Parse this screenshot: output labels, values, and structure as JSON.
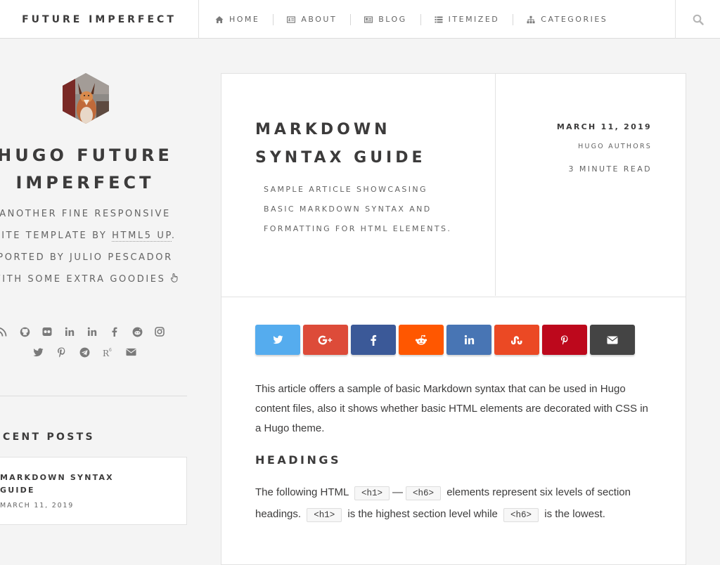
{
  "header": {
    "site_title": "FUTURE IMPERFECT",
    "nav": [
      {
        "label": "HOME",
        "icon": "home-icon"
      },
      {
        "label": "ABOUT",
        "icon": "id-card-icon"
      },
      {
        "label": "BLOG",
        "icon": "newspaper-icon"
      },
      {
        "label": "ITEMIZED",
        "icon": "list-icon"
      },
      {
        "label": "CATEGORIES",
        "icon": "sitemap-icon"
      }
    ],
    "search_icon": "search-icon"
  },
  "sidebar": {
    "blog_title": "HUGO FUTURE IMPERFECT",
    "desc": {
      "part1": "ANOTHER FINE RESPONSIVE SITE TEMPLATE BY ",
      "link1": "HTML5 UP",
      "part2": ". PORTED BY JULIO PESCADOR WITH SOME EXTRA GOODIES "
    },
    "social_row1": [
      "rss-icon",
      "github-icon",
      "flickr-icon",
      "linkedin-icon",
      "linkedin-icon",
      "facebook-icon",
      "reddit-icon",
      "instagram-icon"
    ],
    "social_row2": [
      "twitter-icon",
      "pinterest-icon",
      "telegram-icon",
      "r6-icon",
      "envelope-icon"
    ],
    "recent_posts": {
      "heading": "CENT POSTS",
      "items": [
        {
          "title": "MARKDOWN SYNTAX GUIDE",
          "date": "MARCH 11, 2019"
        }
      ]
    }
  },
  "article": {
    "title": "MARKDOWN SYNTAX GUIDE",
    "subtitle": "SAMPLE ARTICLE SHOWCASING BASIC MARKDOWN SYNTAX AND FORMATTING FOR HTML ELEMENTS.",
    "meta": {
      "date": "MARCH 11, 2019",
      "author": "HUGO AUTHORS",
      "read_time": "3 MINUTE READ"
    },
    "share_buttons": [
      {
        "name": "twitter",
        "color": "#55acee"
      },
      {
        "name": "google-plus",
        "color": "#dd4b39"
      },
      {
        "name": "facebook",
        "color": "#3b5998"
      },
      {
        "name": "reddit",
        "color": "#ff5700"
      },
      {
        "name": "linkedin",
        "color": "#4875b4"
      },
      {
        "name": "stumbleupon",
        "color": "#eb4924"
      },
      {
        "name": "pinterest",
        "color": "#bd081c"
      },
      {
        "name": "email",
        "color": "#444444"
      }
    ],
    "intro": "This article offers a sample of basic Markdown syntax that can be used in Hugo content files, also it shows whether basic HTML elements are decorated with CSS in a Hugo theme.",
    "headings_heading": "HEADINGS",
    "headings_text": {
      "p1": "The following HTML ",
      "c1": "<h1>",
      "dash": "—",
      "c2": "<h6>",
      "p2": " elements represent six levels of section headings. ",
      "c3": "<h1>",
      "p3": " is the highest section level while ",
      "c4": "<h6>",
      "p4": " is the lowest."
    }
  }
}
